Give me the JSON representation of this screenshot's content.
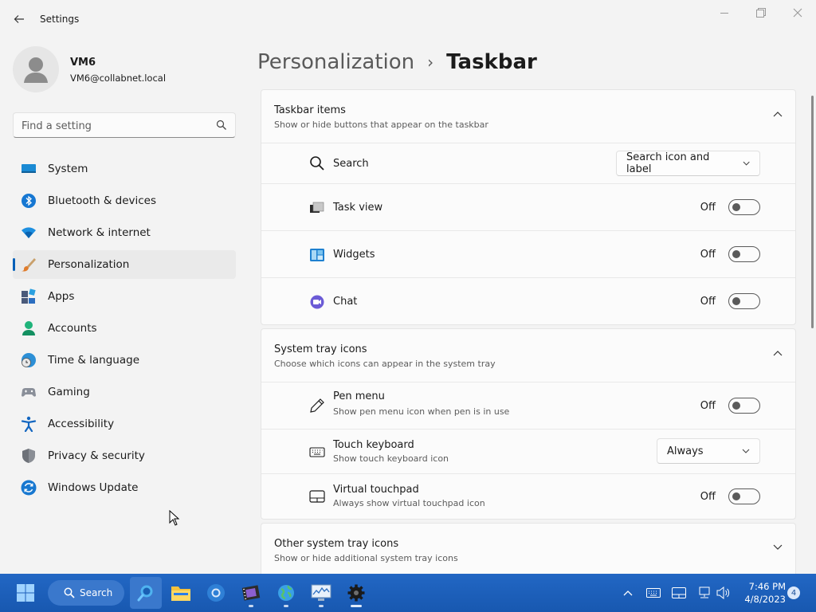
{
  "window": {
    "title": "Settings"
  },
  "user": {
    "name": "VM6",
    "email": "VM6@collabnet.local"
  },
  "search": {
    "placeholder": "Find a setting"
  },
  "sidebar": {
    "items": [
      {
        "label": "System",
        "icon": "system-icon"
      },
      {
        "label": "Bluetooth & devices",
        "icon": "bluetooth-icon"
      },
      {
        "label": "Network & internet",
        "icon": "wifi-icon"
      },
      {
        "label": "Personalization",
        "icon": "brush-icon",
        "active": true
      },
      {
        "label": "Apps",
        "icon": "apps-icon"
      },
      {
        "label": "Accounts",
        "icon": "accounts-icon"
      },
      {
        "label": "Time & language",
        "icon": "globe-clock-icon"
      },
      {
        "label": "Gaming",
        "icon": "controller-icon"
      },
      {
        "label": "Accessibility",
        "icon": "accessibility-icon"
      },
      {
        "label": "Privacy & security",
        "icon": "shield-icon"
      },
      {
        "label": "Windows Update",
        "icon": "update-icon"
      }
    ]
  },
  "breadcrumb": {
    "parent": "Personalization",
    "separator": "›",
    "current": "Taskbar"
  },
  "taskbar_items": {
    "title": "Taskbar items",
    "subtitle": "Show or hide buttons that appear on the taskbar",
    "rows": [
      {
        "label": "Search",
        "value": "Search icon and label",
        "icon": "search-icon"
      },
      {
        "label": "Task view",
        "state": "Off",
        "icon": "task-view-icon"
      },
      {
        "label": "Widgets",
        "state": "Off",
        "icon": "widgets-icon"
      },
      {
        "label": "Chat",
        "state": "Off",
        "icon": "chat-icon"
      }
    ]
  },
  "system_tray": {
    "title": "System tray icons",
    "subtitle": "Choose which icons can appear in the system tray",
    "rows": [
      {
        "label": "Pen menu",
        "sub": "Show pen menu icon when pen is in use",
        "state": "Off",
        "icon": "pen-icon"
      },
      {
        "label": "Touch keyboard",
        "sub": "Show touch keyboard icon",
        "value": "Always",
        "icon": "keyboard-icon"
      },
      {
        "label": "Virtual touchpad",
        "sub": "Always show virtual touchpad icon",
        "state": "Off",
        "icon": "touchpad-icon"
      }
    ]
  },
  "other_tray": {
    "title": "Other system tray icons",
    "subtitle": "Show or hide additional system tray icons"
  },
  "taskbar": {
    "search_label": "Search",
    "time": "7:46 PM",
    "date": "4/8/2023",
    "notification_count": "4"
  },
  "colors": {
    "accent": "#005fb8",
    "taskbar": "#1f63c0"
  }
}
